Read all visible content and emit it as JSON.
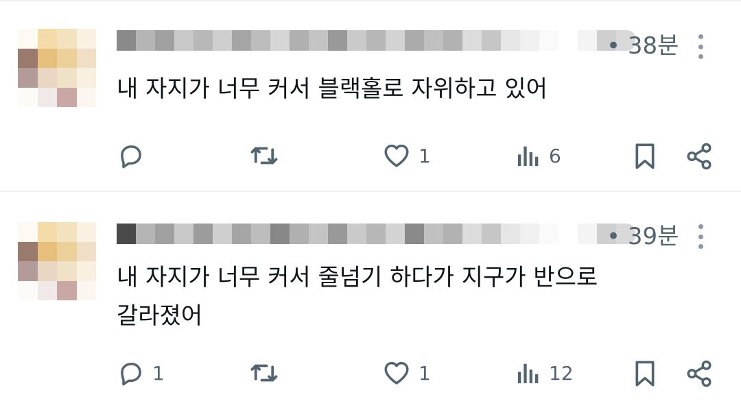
{
  "posts": [
    {
      "time": "• 38분",
      "text": "내 자지가 너무 커서 블랙홀로 자위하고 있어",
      "actions": {
        "replies": "",
        "reposts": "",
        "likes": "1",
        "views": "6"
      }
    },
    {
      "time": "• 39분",
      "text": "내 자지가 너무 커서 줄넘기 하다가 지구가 반으로\n갈라졌어",
      "actions": {
        "replies": "1",
        "reposts": "",
        "likes": "1",
        "views": "12"
      }
    }
  ],
  "icons": {
    "reply": "reply-icon",
    "repost": "repost-icon",
    "like": "heart-icon",
    "views": "analytics-icon",
    "bookmark": "bookmark-icon",
    "share": "share-icon",
    "more": "more-icon"
  },
  "colors": {
    "icon": "#536471",
    "text": "#0f1419",
    "divider": "#eff3f4"
  }
}
